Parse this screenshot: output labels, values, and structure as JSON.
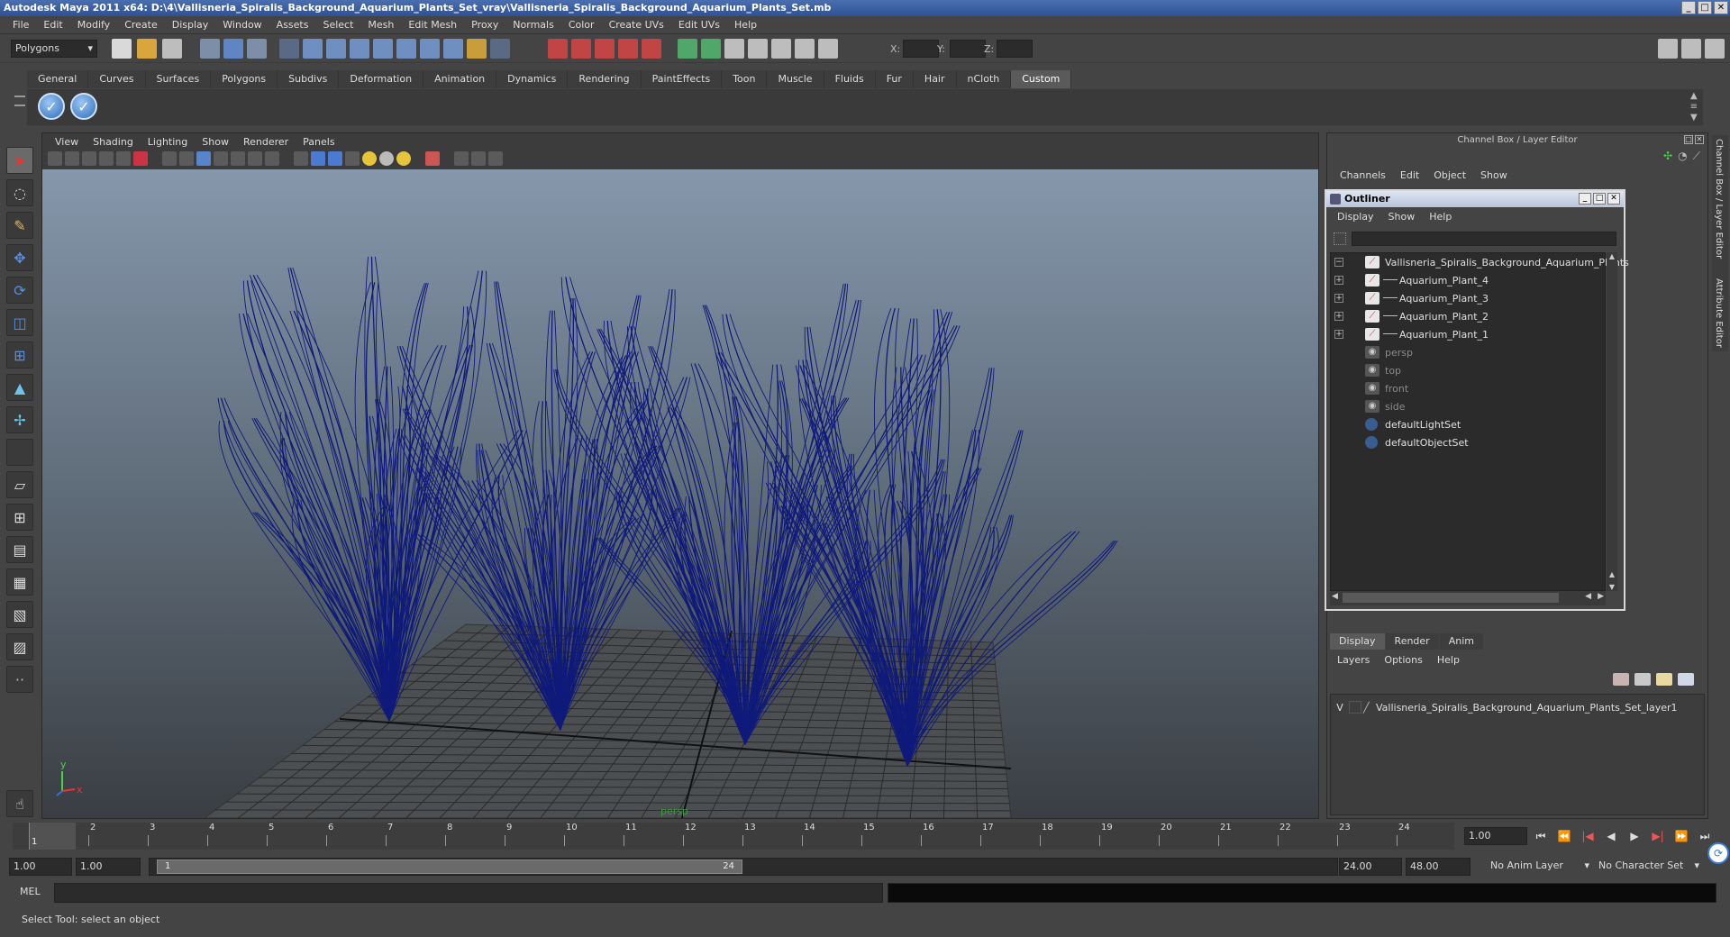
{
  "window": {
    "title": "Autodesk Maya 2011 x64: D:\\4\\Vallisneria_Spiralis_Background_Aquarium_Plants_Set_vray\\Vallisneria_Spiralis_Background_Aquarium_Plants_Set.mb"
  },
  "menubar": [
    "File",
    "Edit",
    "Modify",
    "Create",
    "Display",
    "Window",
    "Assets",
    "Select",
    "Mesh",
    "Edit Mesh",
    "Proxy",
    "Normals",
    "Color",
    "Create UVs",
    "Edit UVs",
    "Help"
  ],
  "statusline": {
    "mode": "Polygons",
    "x_label": "X:",
    "y_label": "Y:",
    "z_label": "Z:"
  },
  "shelf": {
    "tabs": [
      "General",
      "Curves",
      "Surfaces",
      "Polygons",
      "Subdivs",
      "Deformation",
      "Animation",
      "Dynamics",
      "Rendering",
      "PaintEffects",
      "Toon",
      "Muscle",
      "Fluids",
      "Fur",
      "Hair",
      "nCloth",
      "Custom"
    ],
    "active_tab": "Custom"
  },
  "viewport": {
    "menus": [
      "View",
      "Shading",
      "Lighting",
      "Show",
      "Renderer",
      "Panels"
    ],
    "axis_y": "y",
    "axis_x": "x",
    "camera_label": "persp"
  },
  "channelbox": {
    "title": "Channel Box / Layer Editor",
    "menus": [
      "Channels",
      "Edit",
      "Object",
      "Show"
    ],
    "side_tabs": [
      "Channel Box / Layer Editor",
      "Attribute Editor"
    ]
  },
  "outliner": {
    "title": "Outliner",
    "menus": [
      "Display",
      "Show",
      "Help"
    ],
    "items": [
      {
        "label": "Vallisneria_Spiralis_Background_Aquarium_Plants",
        "indent": 0,
        "expander": "−",
        "type": "mesh",
        "dim": false
      },
      {
        "label": "Aquarium_Plant_4",
        "indent": 1,
        "expander": "+",
        "type": "mesh",
        "dim": false
      },
      {
        "label": "Aquarium_Plant_3",
        "indent": 1,
        "expander": "+",
        "type": "mesh",
        "dim": false
      },
      {
        "label": "Aquarium_Plant_2",
        "indent": 1,
        "expander": "+",
        "type": "mesh",
        "dim": false
      },
      {
        "label": "Aquarium_Plant_1",
        "indent": 1,
        "expander": "+",
        "type": "mesh",
        "dim": false
      },
      {
        "label": "persp",
        "indent": 0,
        "expander": "",
        "type": "camera",
        "dim": true
      },
      {
        "label": "top",
        "indent": 0,
        "expander": "",
        "type": "camera",
        "dim": true
      },
      {
        "label": "front",
        "indent": 0,
        "expander": "",
        "type": "camera",
        "dim": true
      },
      {
        "label": "side",
        "indent": 0,
        "expander": "",
        "type": "camera",
        "dim": true
      },
      {
        "label": "defaultLightSet",
        "indent": 0,
        "expander": "",
        "type": "set",
        "dim": false
      },
      {
        "label": "defaultObjectSet",
        "indent": 0,
        "expander": "",
        "type": "set",
        "dim": false
      }
    ]
  },
  "layers": {
    "tabs": [
      "Display",
      "Render",
      "Anim"
    ],
    "active_tab": "Display",
    "menus": [
      "Layers",
      "Options",
      "Help"
    ],
    "rows": [
      {
        "visibility": "V",
        "name": "Vallisneria_Spiralis_Background_Aquarium_Plants_Set_layer1"
      }
    ]
  },
  "timeline": {
    "ticks": [
      "1",
      "2",
      "3",
      "4",
      "5",
      "6",
      "7",
      "8",
      "9",
      "10",
      "11",
      "12",
      "13",
      "14",
      "15",
      "16",
      "17",
      "18",
      "19",
      "20",
      "21",
      "22",
      "23",
      "24"
    ],
    "current_frame_marker": "1",
    "current_frame": "1.00"
  },
  "range": {
    "start_time": "1.00",
    "playback_start": "1.00",
    "slider_start": "1",
    "slider_end": "24",
    "playback_end": "24.00",
    "end_time": "48.00",
    "anim_layer": "No Anim Layer",
    "character_set": "No Character Set"
  },
  "cmdline": {
    "label": "MEL"
  },
  "helpline": {
    "text": "Select Tool: select an object"
  },
  "colors": {
    "wireframe": "#0f1a7a",
    "title_bar": "#2f5193",
    "panel": "#444444"
  }
}
